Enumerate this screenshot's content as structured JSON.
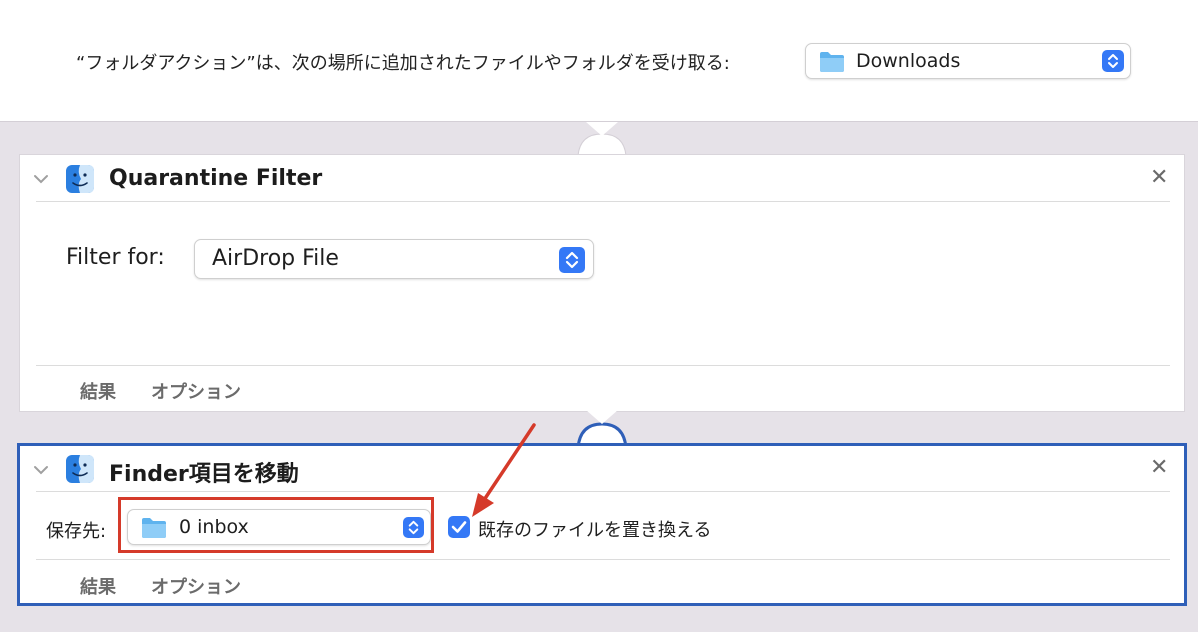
{
  "header": {
    "text": "“フォルダアクション”は、次の場所に追加されたファイルやフォルダを受け取る:",
    "folder_popup": {
      "value": "Downloads",
      "icon": "folder-icon"
    }
  },
  "actions": [
    {
      "title": "Quarantine Filter",
      "icon": "finder-icon",
      "filter_label": "Filter for:",
      "filter_value": "AirDrop File",
      "tabs": [
        "結果",
        "オプション"
      ]
    },
    {
      "title": "Finder項目を移動",
      "icon": "finder-icon",
      "destination_label": "保存先:",
      "destination_value": "0 inbox",
      "replace_checkbox_label": "既存のファイルを置き換える",
      "replace_checked": true,
      "tabs": [
        "結果",
        "オプション"
      ]
    }
  ],
  "colors": {
    "accent": "#3478f6",
    "selection_border": "#2f5fb8",
    "annotation": "#d53a2a",
    "canvas": "#e6e2e8"
  }
}
